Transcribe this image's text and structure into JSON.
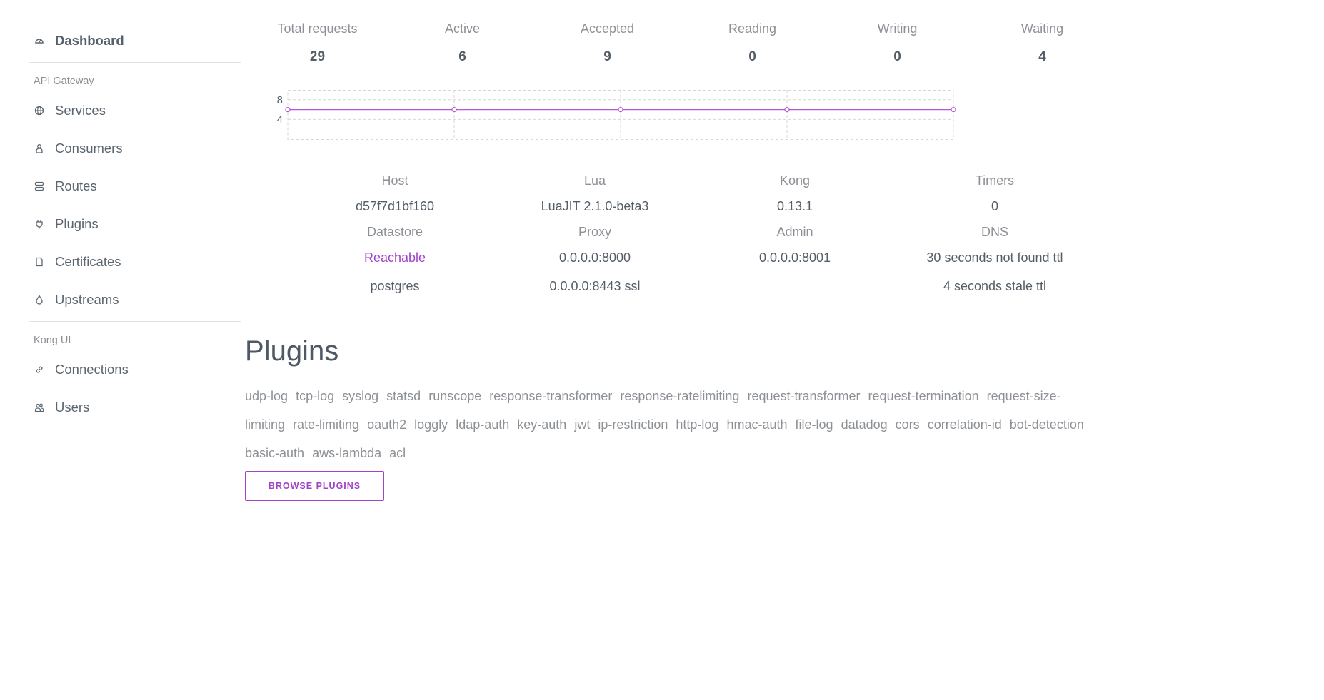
{
  "sidebar": {
    "dashboard": {
      "label": "Dashboard",
      "icon": "gauge-icon"
    },
    "sections": [
      {
        "title": "API Gateway",
        "items": [
          {
            "label": "Services",
            "icon": "globe-icon"
          },
          {
            "label": "Consumers",
            "icon": "person-icon"
          },
          {
            "label": "Routes",
            "icon": "routes-icon"
          },
          {
            "label": "Plugins",
            "icon": "plug-icon"
          },
          {
            "label": "Certificates",
            "icon": "document-icon"
          },
          {
            "label": "Upstreams",
            "icon": "drop-icon"
          }
        ]
      },
      {
        "title": "Kong UI",
        "items": [
          {
            "label": "Connections",
            "icon": "link-icon"
          },
          {
            "label": "Users",
            "icon": "users-icon"
          }
        ]
      }
    ]
  },
  "stats": [
    {
      "label": "Total requests",
      "value": "29"
    },
    {
      "label": "Active",
      "value": "6"
    },
    {
      "label": "Accepted",
      "value": "9"
    },
    {
      "label": "Reading",
      "value": "0"
    },
    {
      "label": "Writing",
      "value": "0"
    },
    {
      "label": "Waiting",
      "value": "4"
    }
  ],
  "chart_data": {
    "type": "line",
    "x": [
      0,
      1,
      2,
      3,
      4
    ],
    "series": [
      {
        "values": [
          6,
          6,
          6,
          6,
          6
        ]
      }
    ],
    "ylim": [
      0,
      10
    ],
    "yticks": [
      "8",
      "4"
    ],
    "grid": true,
    "line_color": "#b557d6"
  },
  "info_rows": [
    {
      "cols": [
        {
          "head": "Host",
          "values": [
            "d57f7d1bf160"
          ]
        },
        {
          "head": "Lua",
          "values": [
            "LuaJIT 2.1.0-beta3"
          ]
        },
        {
          "head": "Kong",
          "values": [
            "0.13.1"
          ]
        },
        {
          "head": "Timers",
          "values": [
            "0"
          ]
        }
      ]
    },
    {
      "cols": [
        {
          "head": "Datastore",
          "values": [
            "Reachable",
            "postgres"
          ],
          "accent_first": true
        },
        {
          "head": "Proxy",
          "values": [
            "0.0.0.0:8000",
            "0.0.0.0:8443 ssl"
          ]
        },
        {
          "head": "Admin",
          "values": [
            "0.0.0.0:8001"
          ]
        },
        {
          "head": "DNS",
          "values": [
            "30 seconds not found ttl",
            "4 seconds stale ttl"
          ]
        }
      ]
    }
  ],
  "plugins": {
    "title": "Plugins",
    "list": [
      "udp-log",
      "tcp-log",
      "syslog",
      "statsd",
      "runscope",
      "response-transformer",
      "response-ratelimiting",
      "request-transformer",
      "request-termination",
      "request-size-limiting",
      "rate-limiting",
      "oauth2",
      "loggly",
      "ldap-auth",
      "key-auth",
      "jwt",
      "ip-restriction",
      "http-log",
      "hmac-auth",
      "file-log",
      "datadog",
      "cors",
      "correlation-id",
      "bot-detection",
      "basic-auth",
      "aws-lambda",
      "acl"
    ],
    "browse_label": "BROWSE PLUGINS"
  },
  "colors": {
    "accent": "#a243c7",
    "text": "#555e68",
    "muted": "#8d9196"
  }
}
